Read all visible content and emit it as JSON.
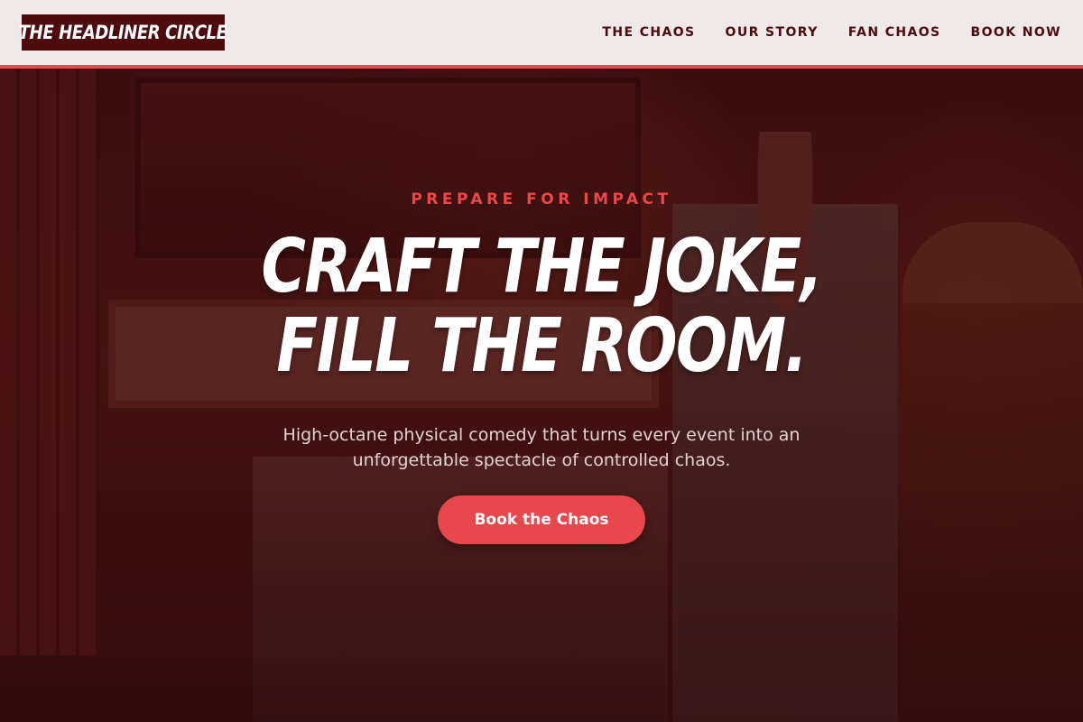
{
  "header": {
    "logo_text": "THE HEADLINER CIRCLE",
    "nav": [
      {
        "label": "THE CHAOS"
      },
      {
        "label": "OUR STORY"
      },
      {
        "label": "FAN CHAOS"
      },
      {
        "label": "BOOK NOW"
      }
    ]
  },
  "hero": {
    "eyebrow": "PREPARE FOR IMPACT",
    "headline_line1": "CRAFT THE JOKE,",
    "headline_line2": "FILL THE ROOM.",
    "subtext": "High-octane physical comedy that turns every event into an unforgettable spectacle of controlled chaos.",
    "cta_label": "Book the Chaos"
  },
  "colors": {
    "accent": "#e8474b",
    "brand_dark": "#4d0b0e",
    "header_bg": "#efe9e9"
  }
}
